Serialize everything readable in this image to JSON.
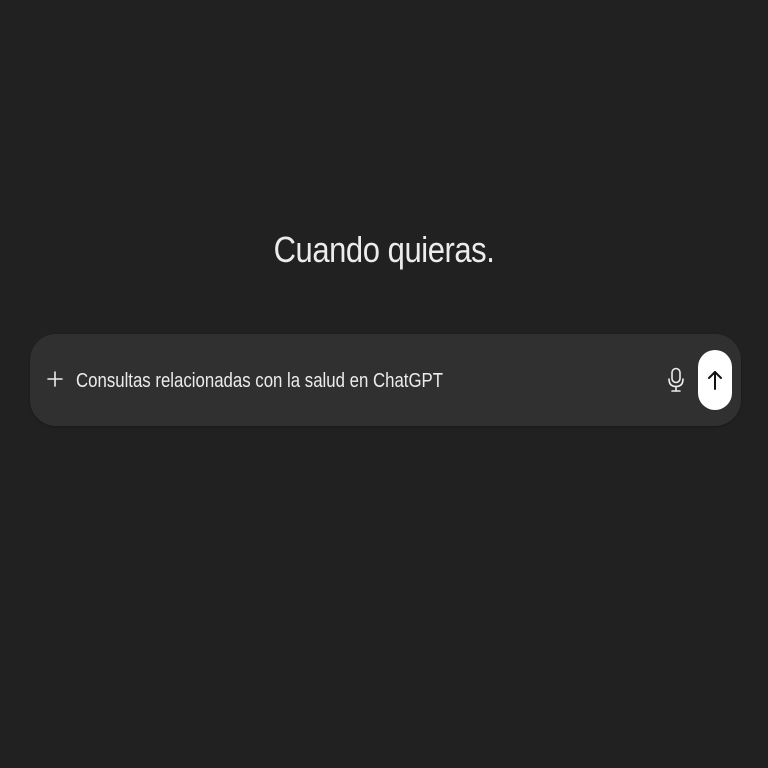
{
  "main": {
    "headline": "Cuando quieras."
  },
  "composer": {
    "value": "Consultas relacionadas con la salud en ChatGPT",
    "icons": {
      "add": "plus-icon",
      "mic": "microphone-icon",
      "send": "arrow-up-icon"
    }
  },
  "colors": {
    "background": "#212121",
    "composer": "#303030",
    "text": "#ececec",
    "send_button": "#ffffff"
  }
}
